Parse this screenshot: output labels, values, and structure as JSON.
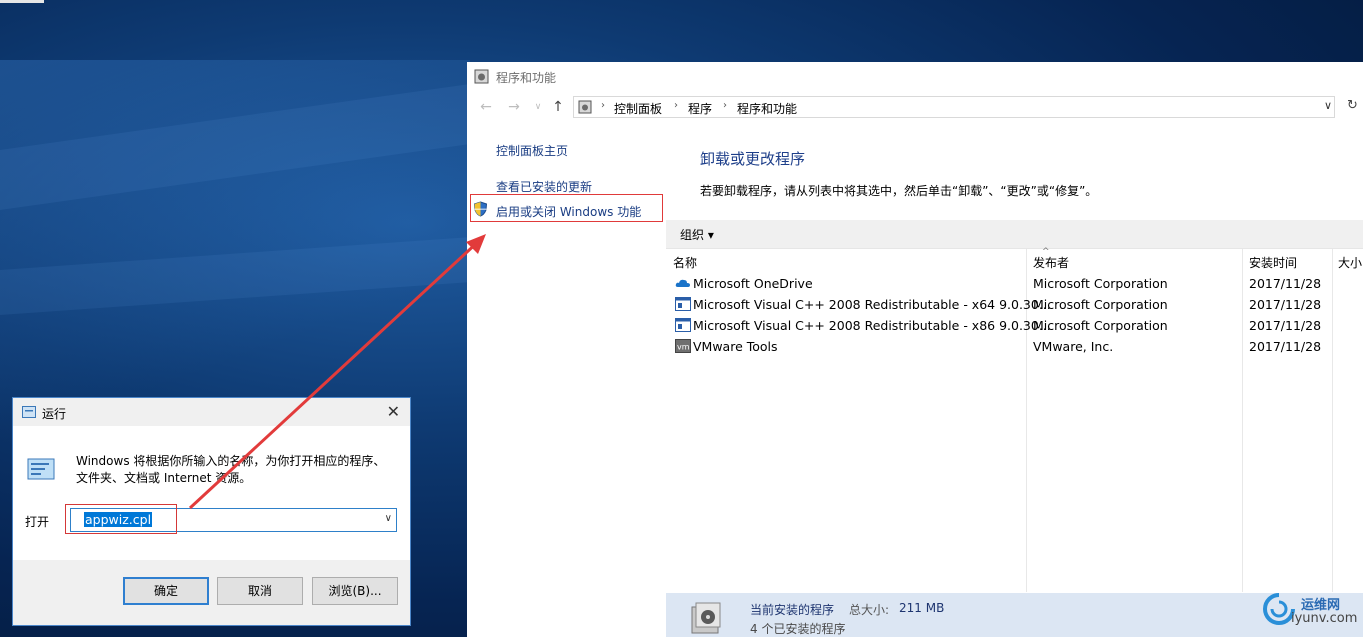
{
  "desktop": {},
  "programs_window": {
    "title": "程序和功能",
    "breadcrumb": [
      "控制面板",
      "程序",
      "程序和功能"
    ],
    "left_links": {
      "home": "控制面板主页",
      "updates": "查看已安装的更新",
      "features": "启用或关闭 Windows 功能"
    },
    "heading": "卸载或更改程序",
    "subtitle": "若要卸载程序，请从列表中将其选中，然后单击“卸载”、“更改”或“修复”。",
    "toolbar": {
      "organize": "组织 ▾"
    },
    "columns": [
      "名称",
      "发布者",
      "安装时间",
      "大小"
    ],
    "programs": [
      {
        "name": "Microsoft OneDrive",
        "publisher": "Microsoft Corporation",
        "date": "2017/11/28",
        "icon": "onedrive-icon"
      },
      {
        "name": "Microsoft Visual C++ 2008 Redistributable - x64 9.0.30...",
        "publisher": "Microsoft Corporation",
        "date": "2017/11/28",
        "icon": "installer-icon"
      },
      {
        "name": "Microsoft Visual C++ 2008 Redistributable - x86 9.0.30...",
        "publisher": "Microsoft Corporation",
        "date": "2017/11/28",
        "icon": "installer-icon"
      },
      {
        "name": "VMware Tools",
        "publisher": "VMware, Inc.",
        "date": "2017/11/28",
        "icon": "vmware-icon"
      }
    ],
    "status": {
      "label": "当前安装的程序",
      "size_label": "总大小:",
      "size_value": "211 MB",
      "count": "4 个已安装的程序"
    }
  },
  "run_dialog": {
    "title": "运行",
    "description": "Windows 将根据你所输入的名称，为你打开相应的程序、文件夹、文档或 Internet 资源。",
    "open_label": "打开",
    "input_value": "appwiz.cpl",
    "buttons": {
      "ok": "确定",
      "cancel": "取消",
      "browse": "浏览(B)..."
    }
  },
  "watermark": {
    "brand": "运维网",
    "url": "iyunv.com"
  },
  "colors": {
    "accent": "#0078d7",
    "link": "#1a3d83",
    "annotation_red": "#e03a3a"
  }
}
